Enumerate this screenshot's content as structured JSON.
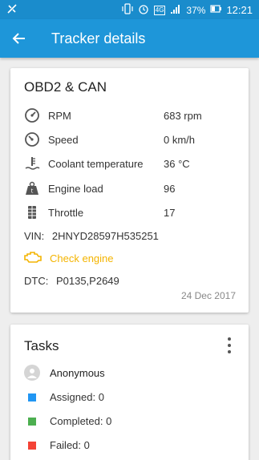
{
  "status_bar": {
    "battery": "37%",
    "time": "12:21",
    "network": "4G"
  },
  "header": {
    "title": "Tracker details"
  },
  "obd_card": {
    "title": "OBD2 & CAN",
    "metrics": [
      {
        "label": "RPM",
        "value": "683 rpm",
        "icon": "gauge-icon"
      },
      {
        "label": "Speed",
        "value": "0 km/h",
        "icon": "speedometer-icon"
      },
      {
        "label": "Coolant temperature",
        "value": "36 °C",
        "icon": "coolant-icon"
      },
      {
        "label": "Engine load",
        "value": "96",
        "icon": "weight-icon"
      },
      {
        "label": "Throttle",
        "value": "17",
        "icon": "throttle-icon"
      }
    ],
    "vin_label": "VIN:",
    "vin": "2HNYD28597H535251",
    "check_engine": "Check engine",
    "dtc_label": "DTC:",
    "dtc": "P0135,P2649",
    "date": "24 Dec 2017"
  },
  "tasks_card": {
    "title": "Tasks",
    "assignee": "Anonymous",
    "items": [
      {
        "label": "Assigned: 0",
        "color": "#2196f3"
      },
      {
        "label": "Completed: 0",
        "color": "#4caf50"
      },
      {
        "label": "Failed: 0",
        "color": "#f44336"
      }
    ]
  },
  "colors": {
    "status_bar": "#1a8ccc",
    "app_bar": "#1e96d9",
    "warning": "#f4b400"
  }
}
